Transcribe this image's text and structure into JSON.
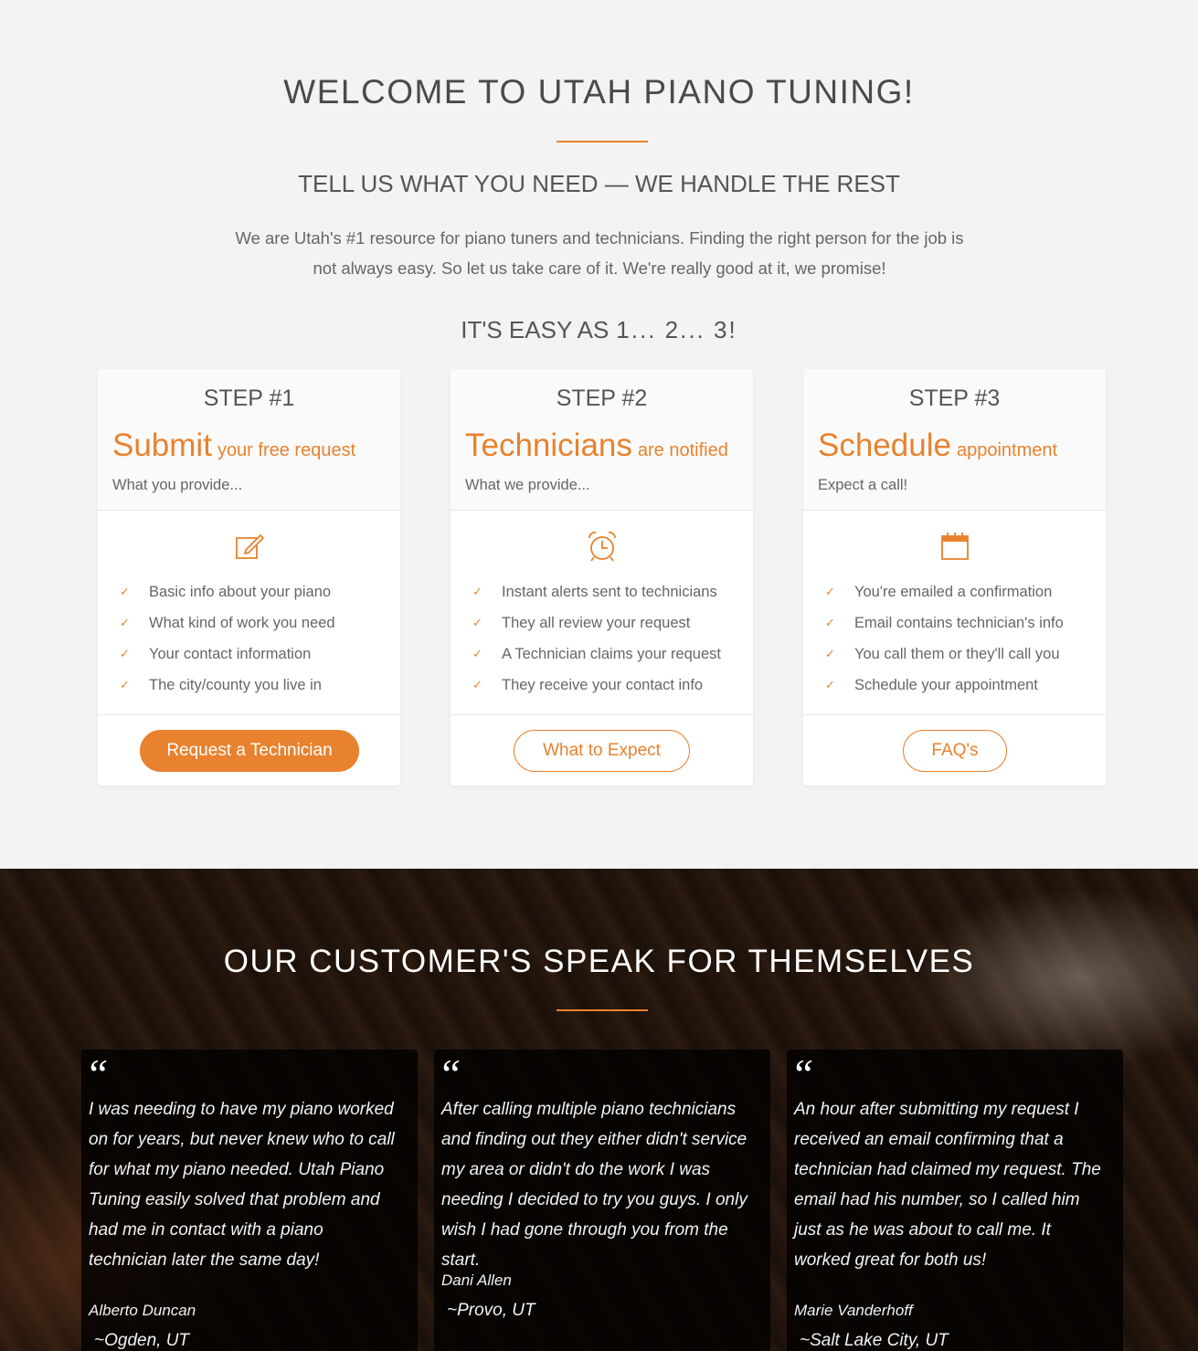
{
  "welcome": {
    "title": "WELCOME TO UTAH PIANO TUNING!",
    "subtitle": "TELL US WHAT YOU NEED — WE HANDLE THE REST",
    "intro": "We are Utah's #1 resource for piano tuners and technicians.  Finding the right person for the job is not always easy.  So let us take care of it.  We're really good at it, we promise!",
    "easy_label": "IT'S EASY AS",
    "easy_nums": "1... 2... 3!"
  },
  "steps": [
    {
      "label": "STEP #1",
      "title_big": "Submit",
      "title_small": "your free request",
      "subtitle": "What you provide...",
      "icon": "edit-icon",
      "items": [
        "Basic info about your piano",
        "What kind of work you need",
        "Your contact information",
        "The city/county you live in"
      ],
      "button": "Request a Technician"
    },
    {
      "label": "STEP #2",
      "title_big": "Technicians",
      "title_small": "are notified",
      "subtitle": "What we provide...",
      "icon": "alarm-clock-icon",
      "items": [
        "Instant alerts sent to technicians",
        "They all review your request",
        "A Technician claims your request",
        "They receive your contact info"
      ],
      "button": "What to Expect"
    },
    {
      "label": "STEP #3",
      "title_big": "Schedule",
      "title_small": "appointment",
      "subtitle": "Expect a call!",
      "icon": "calendar-icon",
      "items": [
        "You're emailed a confirmation",
        "Email contains technician's info",
        "You call them or they'll call you",
        "Schedule your appointment"
      ],
      "button": "FAQ's"
    }
  ],
  "check_glyph": "✓",
  "testimonials": {
    "heading": "OUR CUSTOMER'S SPEAK FOR THEMSELVES",
    "quote_glyph": "“",
    "items": [
      {
        "text": "I was needing to have my piano worked on for years, but never knew who to call for what my piano needed. Utah Piano Tuning easily solved that problem and had me in contact with a piano technician later the same day!",
        "author": "Alberto Duncan",
        "city": "~Ogden, UT"
      },
      {
        "text": "After calling multiple piano technicians and finding out they either didn't service my area or didn't do the work I was needing I decided to try you guys. I only wish I had gone through you from the start.",
        "author": "Dani Allen",
        "city": "~Provo, UT"
      },
      {
        "text": "An hour after submitting my request I received an email confirming that a technician had claimed my request. The email had his number, so I called him just as he was about to call me. It worked great for both us!",
        "author": "Marie Vanderhoff",
        "city": "~Salt Lake City, UT"
      }
    ]
  },
  "colors": {
    "accent": "#e8822e",
    "background": "#f3f3f3",
    "card": "#ffffff"
  }
}
